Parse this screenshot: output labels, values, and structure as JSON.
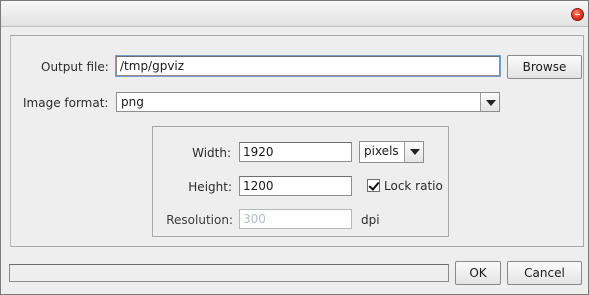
{
  "window": {
    "close_icon": "close-icon"
  },
  "output_file": {
    "label": "Output file:",
    "value": "/tmp/gpviz",
    "browse_label": "Browse"
  },
  "image_format": {
    "label": "Image format:",
    "value": "png"
  },
  "size": {
    "width_label": "Width:",
    "width_value": "1920",
    "unit_value": "pixels",
    "height_label": "Height:",
    "height_value": "1200",
    "lock_ratio_label": "Lock ratio",
    "lock_ratio_checked": true,
    "resolution_label": "Resolution:",
    "resolution_value": "300",
    "resolution_unit": "dpi"
  },
  "footer": {
    "progress": 0,
    "ok_label": "OK",
    "cancel_label": "Cancel"
  }
}
